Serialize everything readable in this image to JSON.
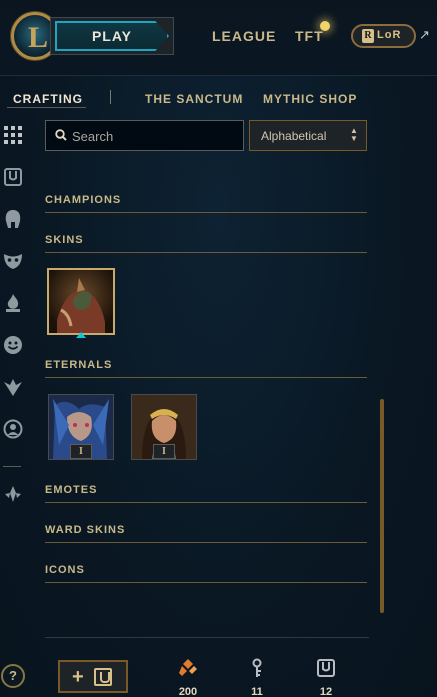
{
  "topbar": {
    "play_label": "PLAY",
    "nav": [
      "LEAGUE",
      "TFT"
    ],
    "lor_badge": "R",
    "lor_label": "LoR",
    "external_link": "↗"
  },
  "subnav": {
    "crafting": "CRAFTING",
    "sanctum": "THE SANCTUM",
    "mythic_shop": "MYTHIC SHOP"
  },
  "search": {
    "placeholder": "Search",
    "value": ""
  },
  "sort": {
    "selected": "Alphabetical"
  },
  "sections": {
    "champions": "CHAMPIONS",
    "skins": "SKINS",
    "eternals": "ETERNALS",
    "emotes": "EMOTES",
    "ward_skins": "WARD SKINS",
    "icons": "ICONS"
  },
  "eternals": [
    {
      "badge": "I"
    },
    {
      "badge": "I"
    }
  ],
  "bottom": {
    "help": "?",
    "add_chest": "+",
    "currencies": [
      {
        "icon": "orange-essence-icon",
        "count": "200"
      },
      {
        "icon": "key-icon",
        "count": "11"
      },
      {
        "icon": "chest-icon",
        "count": "12"
      }
    ]
  },
  "colors": {
    "gold": "#c8aa6e",
    "accent_blue": "#1ca6c4",
    "orange_essence": "#e07b2c"
  }
}
